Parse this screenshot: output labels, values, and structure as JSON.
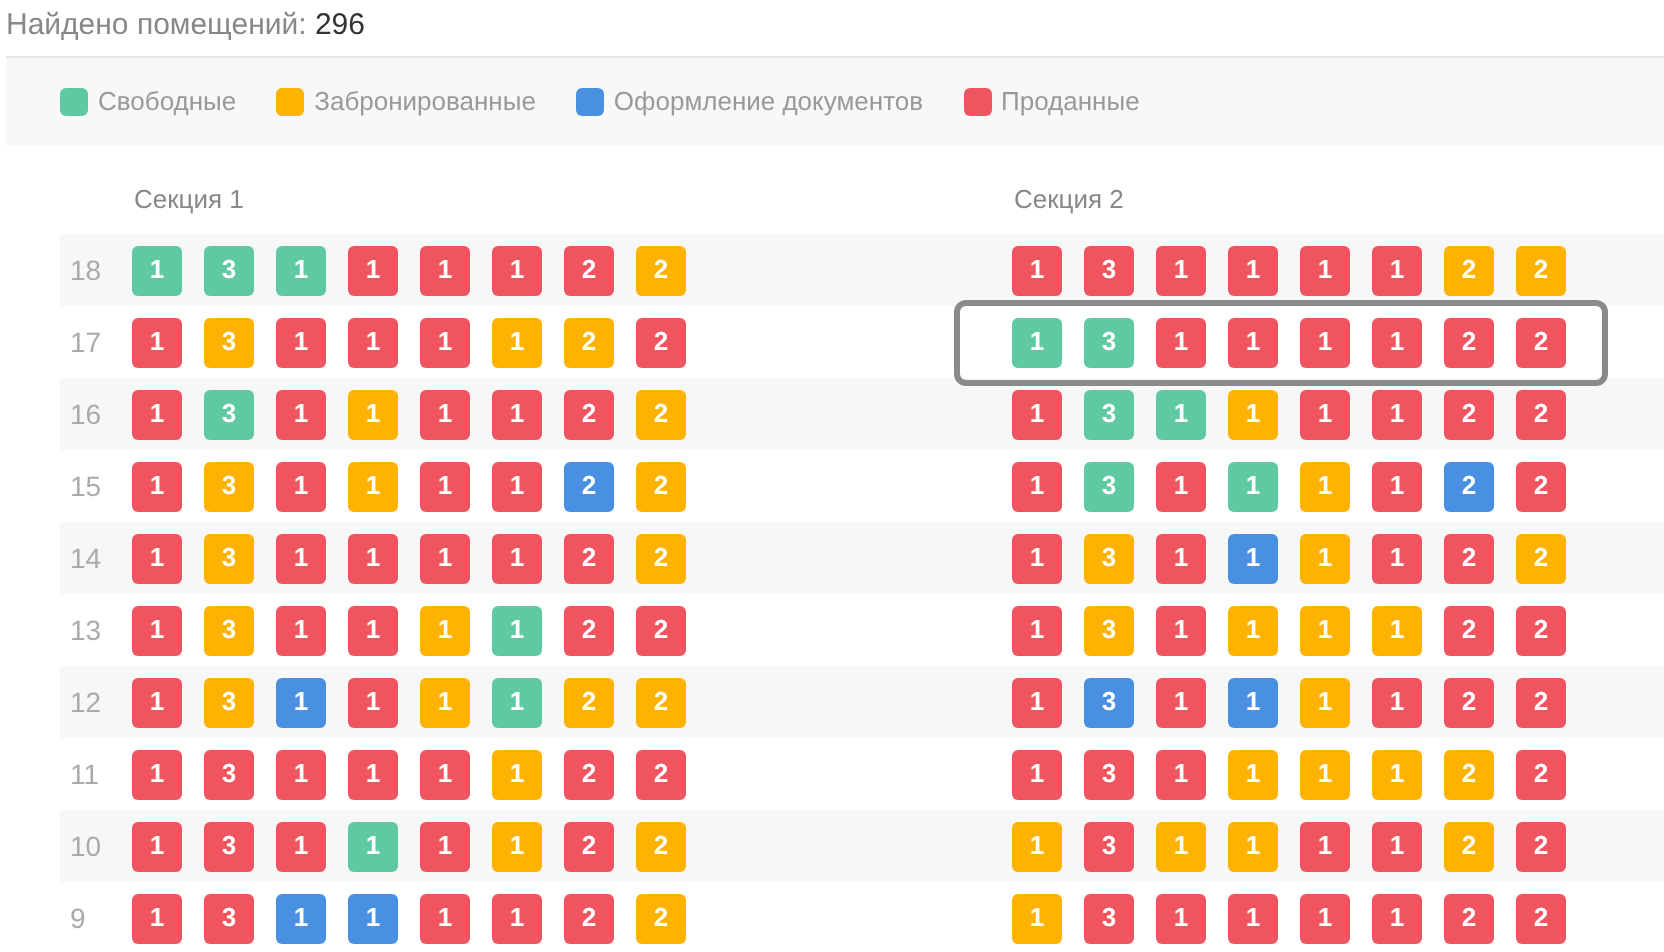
{
  "found": {
    "label": "Найдено помещений:",
    "count": "296"
  },
  "legend": [
    {
      "label": "Свободные",
      "color": "#5fc9a2"
    },
    {
      "label": "Забронированные",
      "color": "#ffb300"
    },
    {
      "label": "Оформление документов",
      "color": "#4a90e2"
    },
    {
      "label": "Проданные",
      "color": "#f0545f"
    }
  ],
  "sections": [
    {
      "title": "Секция 1",
      "rows": [
        {
          "floor": "18",
          "selected": false,
          "cells": [
            {
              "label": "1",
              "color": "#5fc9a2"
            },
            {
              "label": "3",
              "color": "#5fc9a2"
            },
            {
              "label": "1",
              "color": "#5fc9a2"
            },
            {
              "label": "1",
              "color": "#f0545f"
            },
            {
              "label": "1",
              "color": "#f0545f"
            },
            {
              "label": "1",
              "color": "#f0545f"
            },
            {
              "label": "2",
              "color": "#f0545f"
            },
            {
              "label": "2",
              "color": "#ffb300"
            }
          ]
        },
        {
          "floor": "17",
          "selected": false,
          "cells": [
            {
              "label": "1",
              "color": "#f0545f"
            },
            {
              "label": "3",
              "color": "#ffb300"
            },
            {
              "label": "1",
              "color": "#f0545f"
            },
            {
              "label": "1",
              "color": "#f0545f"
            },
            {
              "label": "1",
              "color": "#f0545f"
            },
            {
              "label": "1",
              "color": "#ffb300"
            },
            {
              "label": "2",
              "color": "#ffb300"
            },
            {
              "label": "2",
              "color": "#f0545f"
            }
          ]
        },
        {
          "floor": "16",
          "selected": false,
          "cells": [
            {
              "label": "1",
              "color": "#f0545f"
            },
            {
              "label": "3",
              "color": "#5fc9a2"
            },
            {
              "label": "1",
              "color": "#f0545f"
            },
            {
              "label": "1",
              "color": "#ffb300"
            },
            {
              "label": "1",
              "color": "#f0545f"
            },
            {
              "label": "1",
              "color": "#f0545f"
            },
            {
              "label": "2",
              "color": "#f0545f"
            },
            {
              "label": "2",
              "color": "#ffb300"
            }
          ]
        },
        {
          "floor": "15",
          "selected": false,
          "cells": [
            {
              "label": "1",
              "color": "#f0545f"
            },
            {
              "label": "3",
              "color": "#ffb300"
            },
            {
              "label": "1",
              "color": "#f0545f"
            },
            {
              "label": "1",
              "color": "#ffb300"
            },
            {
              "label": "1",
              "color": "#f0545f"
            },
            {
              "label": "1",
              "color": "#f0545f"
            },
            {
              "label": "2",
              "color": "#4a90e2"
            },
            {
              "label": "2",
              "color": "#ffb300"
            }
          ]
        },
        {
          "floor": "14",
          "selected": false,
          "cells": [
            {
              "label": "1",
              "color": "#f0545f"
            },
            {
              "label": "3",
              "color": "#ffb300"
            },
            {
              "label": "1",
              "color": "#f0545f"
            },
            {
              "label": "1",
              "color": "#f0545f"
            },
            {
              "label": "1",
              "color": "#f0545f"
            },
            {
              "label": "1",
              "color": "#f0545f"
            },
            {
              "label": "2",
              "color": "#f0545f"
            },
            {
              "label": "2",
              "color": "#ffb300"
            }
          ]
        },
        {
          "floor": "13",
          "selected": false,
          "cells": [
            {
              "label": "1",
              "color": "#f0545f"
            },
            {
              "label": "3",
              "color": "#ffb300"
            },
            {
              "label": "1",
              "color": "#f0545f"
            },
            {
              "label": "1",
              "color": "#f0545f"
            },
            {
              "label": "1",
              "color": "#ffb300"
            },
            {
              "label": "1",
              "color": "#5fc9a2"
            },
            {
              "label": "2",
              "color": "#f0545f"
            },
            {
              "label": "2",
              "color": "#f0545f"
            }
          ]
        },
        {
          "floor": "12",
          "selected": false,
          "cells": [
            {
              "label": "1",
              "color": "#f0545f"
            },
            {
              "label": "3",
              "color": "#ffb300"
            },
            {
              "label": "1",
              "color": "#4a90e2"
            },
            {
              "label": "1",
              "color": "#f0545f"
            },
            {
              "label": "1",
              "color": "#ffb300"
            },
            {
              "label": "1",
              "color": "#5fc9a2"
            },
            {
              "label": "2",
              "color": "#ffb300"
            },
            {
              "label": "2",
              "color": "#ffb300"
            }
          ]
        },
        {
          "floor": "11",
          "selected": false,
          "cells": [
            {
              "label": "1",
              "color": "#f0545f"
            },
            {
              "label": "3",
              "color": "#f0545f"
            },
            {
              "label": "1",
              "color": "#f0545f"
            },
            {
              "label": "1",
              "color": "#f0545f"
            },
            {
              "label": "1",
              "color": "#f0545f"
            },
            {
              "label": "1",
              "color": "#ffb300"
            },
            {
              "label": "2",
              "color": "#f0545f"
            },
            {
              "label": "2",
              "color": "#f0545f"
            }
          ]
        },
        {
          "floor": "10",
          "selected": false,
          "cells": [
            {
              "label": "1",
              "color": "#f0545f"
            },
            {
              "label": "3",
              "color": "#f0545f"
            },
            {
              "label": "1",
              "color": "#f0545f"
            },
            {
              "label": "1",
              "color": "#5fc9a2"
            },
            {
              "label": "1",
              "color": "#f0545f"
            },
            {
              "label": "1",
              "color": "#ffb300"
            },
            {
              "label": "2",
              "color": "#f0545f"
            },
            {
              "label": "2",
              "color": "#ffb300"
            }
          ]
        },
        {
          "floor": "9",
          "selected": false,
          "cells": [
            {
              "label": "1",
              "color": "#f0545f"
            },
            {
              "label": "3",
              "color": "#f0545f"
            },
            {
              "label": "1",
              "color": "#4a90e2"
            },
            {
              "label": "1",
              "color": "#4a90e2"
            },
            {
              "label": "1",
              "color": "#f0545f"
            },
            {
              "label": "1",
              "color": "#f0545f"
            },
            {
              "label": "2",
              "color": "#f0545f"
            },
            {
              "label": "2",
              "color": "#ffb300"
            }
          ]
        }
      ]
    },
    {
      "title": "Секция 2",
      "rows": [
        {
          "selected": false,
          "cells": [
            {
              "label": "1",
              "color": "#f0545f"
            },
            {
              "label": "3",
              "color": "#f0545f"
            },
            {
              "label": "1",
              "color": "#f0545f"
            },
            {
              "label": "1",
              "color": "#f0545f"
            },
            {
              "label": "1",
              "color": "#f0545f"
            },
            {
              "label": "1",
              "color": "#f0545f"
            },
            {
              "label": "2",
              "color": "#ffb300"
            },
            {
              "label": "2",
              "color": "#ffb300"
            }
          ]
        },
        {
          "selected": true,
          "cells": [
            {
              "label": "1",
              "color": "#5fc9a2"
            },
            {
              "label": "3",
              "color": "#5fc9a2"
            },
            {
              "label": "1",
              "color": "#f0545f"
            },
            {
              "label": "1",
              "color": "#f0545f"
            },
            {
              "label": "1",
              "color": "#f0545f"
            },
            {
              "label": "1",
              "color": "#f0545f"
            },
            {
              "label": "2",
              "color": "#f0545f"
            },
            {
              "label": "2",
              "color": "#f0545f"
            }
          ]
        },
        {
          "selected": false,
          "cells": [
            {
              "label": "1",
              "color": "#f0545f"
            },
            {
              "label": "3",
              "color": "#5fc9a2"
            },
            {
              "label": "1",
              "color": "#5fc9a2"
            },
            {
              "label": "1",
              "color": "#ffb300"
            },
            {
              "label": "1",
              "color": "#f0545f"
            },
            {
              "label": "1",
              "color": "#f0545f"
            },
            {
              "label": "2",
              "color": "#f0545f"
            },
            {
              "label": "2",
              "color": "#f0545f"
            }
          ]
        },
        {
          "selected": false,
          "cells": [
            {
              "label": "1",
              "color": "#f0545f"
            },
            {
              "label": "3",
              "color": "#5fc9a2"
            },
            {
              "label": "1",
              "color": "#f0545f"
            },
            {
              "label": "1",
              "color": "#5fc9a2"
            },
            {
              "label": "1",
              "color": "#ffb300"
            },
            {
              "label": "1",
              "color": "#f0545f"
            },
            {
              "label": "2",
              "color": "#4a90e2"
            },
            {
              "label": "2",
              "color": "#f0545f"
            }
          ]
        },
        {
          "selected": false,
          "cells": [
            {
              "label": "1",
              "color": "#f0545f"
            },
            {
              "label": "3",
              "color": "#ffb300"
            },
            {
              "label": "1",
              "color": "#f0545f"
            },
            {
              "label": "1",
              "color": "#4a90e2"
            },
            {
              "label": "1",
              "color": "#ffb300"
            },
            {
              "label": "1",
              "color": "#f0545f"
            },
            {
              "label": "2",
              "color": "#f0545f"
            },
            {
              "label": "2",
              "color": "#ffb300"
            }
          ]
        },
        {
          "selected": false,
          "cells": [
            {
              "label": "1",
              "color": "#f0545f"
            },
            {
              "label": "3",
              "color": "#ffb300"
            },
            {
              "label": "1",
              "color": "#f0545f"
            },
            {
              "label": "1",
              "color": "#ffb300"
            },
            {
              "label": "1",
              "color": "#ffb300"
            },
            {
              "label": "1",
              "color": "#ffb300"
            },
            {
              "label": "2",
              "color": "#f0545f"
            },
            {
              "label": "2",
              "color": "#f0545f"
            }
          ]
        },
        {
          "selected": false,
          "cells": [
            {
              "label": "1",
              "color": "#f0545f"
            },
            {
              "label": "3",
              "color": "#4a90e2"
            },
            {
              "label": "1",
              "color": "#f0545f"
            },
            {
              "label": "1",
              "color": "#4a90e2"
            },
            {
              "label": "1",
              "color": "#ffb300"
            },
            {
              "label": "1",
              "color": "#f0545f"
            },
            {
              "label": "2",
              "color": "#f0545f"
            },
            {
              "label": "2",
              "color": "#f0545f"
            }
          ]
        },
        {
          "selected": false,
          "cells": [
            {
              "label": "1",
              "color": "#f0545f"
            },
            {
              "label": "3",
              "color": "#f0545f"
            },
            {
              "label": "1",
              "color": "#f0545f"
            },
            {
              "label": "1",
              "color": "#ffb300"
            },
            {
              "label": "1",
              "color": "#ffb300"
            },
            {
              "label": "1",
              "color": "#ffb300"
            },
            {
              "label": "2",
              "color": "#ffb300"
            },
            {
              "label": "2",
              "color": "#f0545f"
            }
          ]
        },
        {
          "selected": false,
          "cells": [
            {
              "label": "1",
              "color": "#ffb300"
            },
            {
              "label": "3",
              "color": "#f0545f"
            },
            {
              "label": "1",
              "color": "#ffb300"
            },
            {
              "label": "1",
              "color": "#ffb300"
            },
            {
              "label": "1",
              "color": "#f0545f"
            },
            {
              "label": "1",
              "color": "#f0545f"
            },
            {
              "label": "2",
              "color": "#ffb300"
            },
            {
              "label": "2",
              "color": "#f0545f"
            }
          ]
        },
        {
          "selected": false,
          "cells": [
            {
              "label": "1",
              "color": "#ffb300"
            },
            {
              "label": "3",
              "color": "#f0545f"
            },
            {
              "label": "1",
              "color": "#f0545f"
            },
            {
              "label": "1",
              "color": "#f0545f"
            },
            {
              "label": "1",
              "color": "#f0545f"
            },
            {
              "label": "1",
              "color": "#f0545f"
            },
            {
              "label": "2",
              "color": "#f0545f"
            },
            {
              "label": "2",
              "color": "#f0545f"
            }
          ]
        }
      ]
    }
  ]
}
